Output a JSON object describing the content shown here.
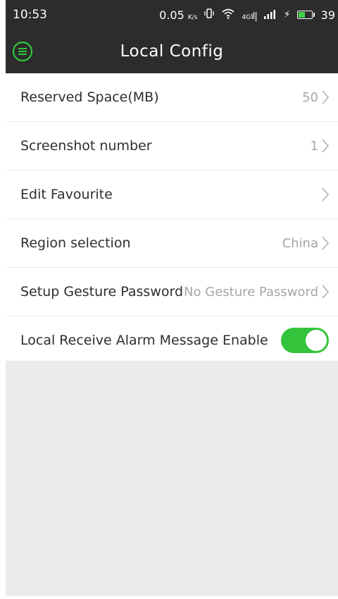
{
  "status_bar": {
    "time": "10:53",
    "net_speed": "0.05",
    "net_unit": "K/s",
    "network_type": "4G",
    "battery_level": "39"
  },
  "app_bar": {
    "title": "Local Config",
    "menu_icon": "menu-circle-icon"
  },
  "settings": [
    {
      "label": "Reserved Space(MB)",
      "value": "50"
    },
    {
      "label": "Screenshot number",
      "value": "1"
    },
    {
      "label": "Edit Favourite",
      "value": ""
    },
    {
      "label": "Region selection",
      "value": "China"
    },
    {
      "label": "Setup Gesture Password",
      "value": "No Gesture Password"
    }
  ],
  "alarm_toggle": {
    "label": "Local Receive Alarm Message Enable",
    "enabled": true
  },
  "colors": {
    "accent_green": "#33c43b",
    "header_bg": "#2c2c2c",
    "empty_area": "#ebebeb"
  }
}
